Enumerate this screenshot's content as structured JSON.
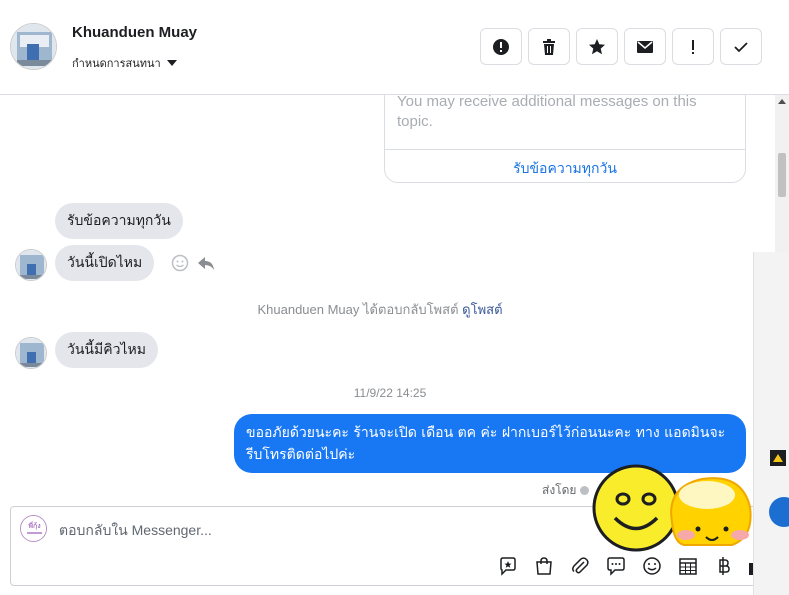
{
  "header": {
    "name": "Khuanduen Muay",
    "subtitle": "กำหนดการสนทนา",
    "actions": [
      {
        "icon": "alert-circle-icon",
        "glyph": "!"
      },
      {
        "icon": "trash-icon"
      },
      {
        "icon": "star-icon"
      },
      {
        "icon": "envelope-icon"
      },
      {
        "icon": "exclamation-icon",
        "glyph": "!"
      },
      {
        "icon": "checkmark-icon"
      }
    ]
  },
  "topic_card": {
    "text": "You may receive additional messages on this topic.",
    "link": "รับข้อความทุกวัน"
  },
  "messages": {
    "incoming_1": "รับข้อความทุกวัน",
    "incoming_2": "วันนี้เปิดไหม",
    "system_note": "Khuanduen Muay ได้ตอบกลับโพสต์",
    "system_link": "ดูโพสต์",
    "incoming_3": "วันนี้มีคิวไหม",
    "timestamp": "11/9/22 14:25",
    "outgoing": "ขออภัยด้วยนะคะ  ร้านจะเปิด เดือน ตค ค่ะ ฝากเบอร์ไว้ก่อนนะคะ ทาง แอดมินจะ รีบโทรติดต่อไปค่ะ",
    "sent_by": "ส่งโดย"
  },
  "reply": {
    "placeholder": "ตอบกลับใน Messenger...",
    "tools": [
      "sticker-star-icon",
      "shopping-bag-icon",
      "paperclip-icon",
      "chat-bubble-icon",
      "emoji-icon",
      "table-icon",
      "baht-icon"
    ]
  },
  "colors": {
    "accent": "#1877f2",
    "bubble_in": "#e4e6eb",
    "link": "#1b74e4",
    "muted": "#8a8d91"
  }
}
